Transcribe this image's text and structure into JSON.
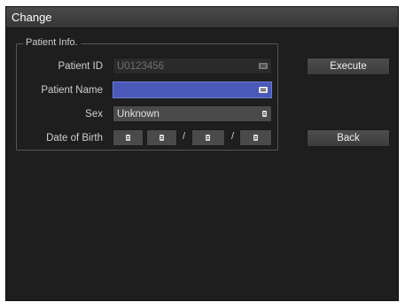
{
  "window": {
    "title": "Change"
  },
  "patient_info": {
    "legend": "Patient Info.",
    "patient_id": {
      "label": "Patient ID",
      "value": "U0123456",
      "icon": "keyboard-icon"
    },
    "patient_name": {
      "label": "Patient Name",
      "value": "",
      "icon": "keyboard-icon"
    },
    "sex": {
      "label": "Sex",
      "value": "Unknown",
      "icon": "list-icon"
    },
    "date_of_birth": {
      "label": "Date of Birth",
      "separator_1": "/",
      "separator_2": "/"
    }
  },
  "buttons": {
    "execute": "Execute",
    "back": "Back"
  },
  "colors": {
    "window_bg": "#1e1e1e",
    "active_field": "#4a58b8",
    "field_bg": "#4a4a4a",
    "text": "#d0d0d0"
  }
}
